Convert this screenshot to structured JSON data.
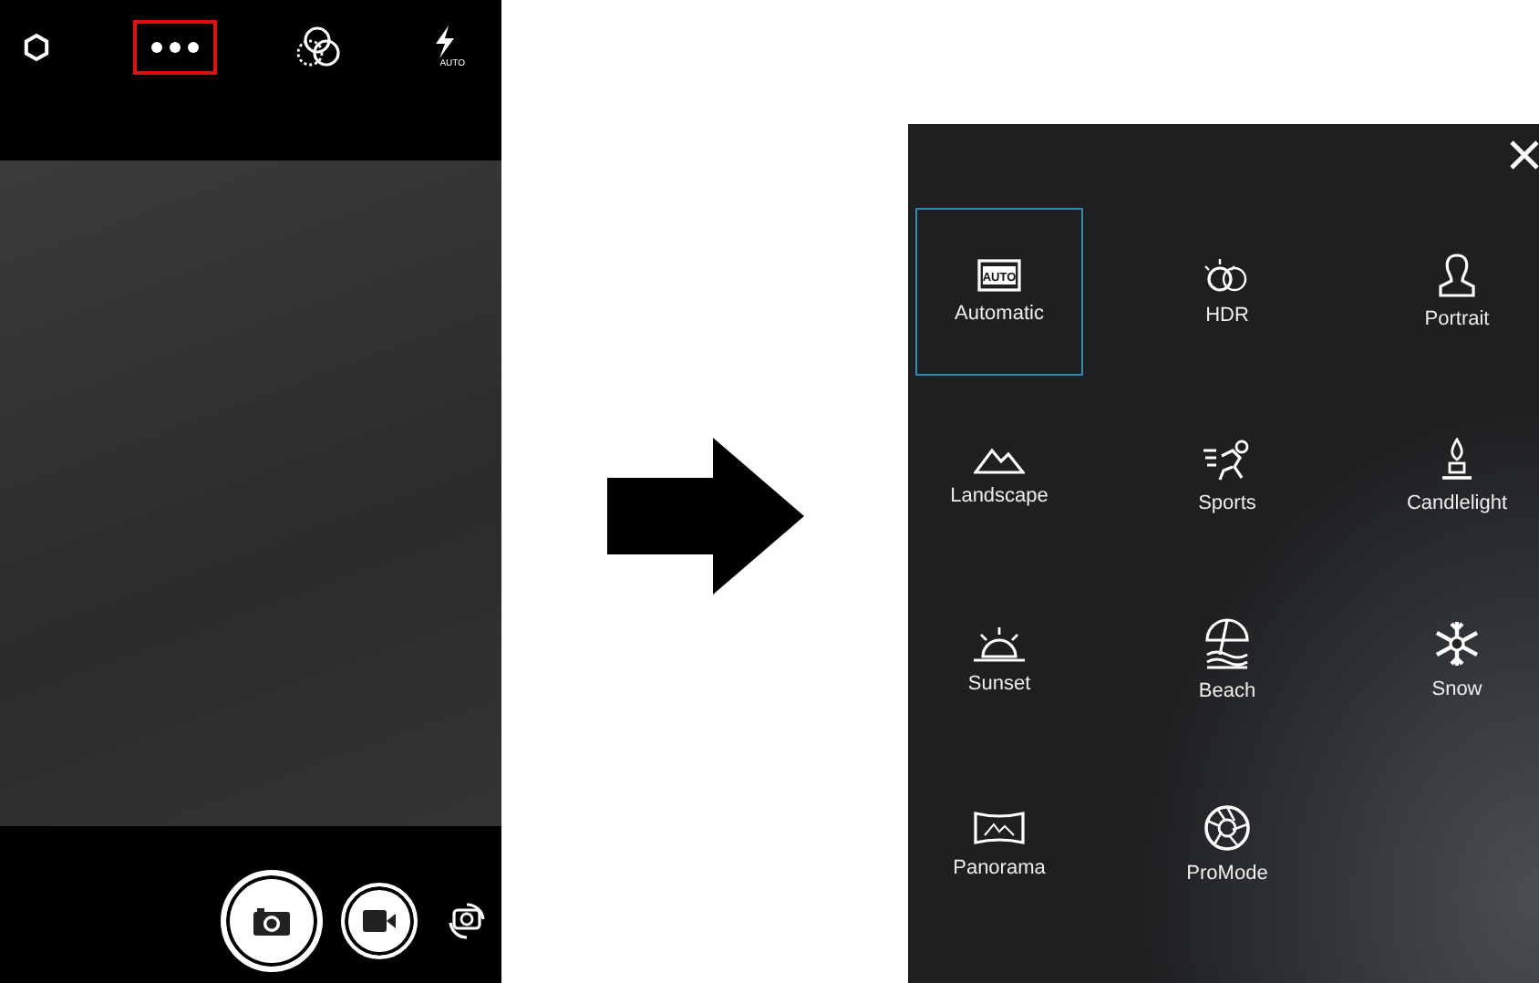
{
  "camera_screen": {
    "top_bar": [
      {
        "kind": "settings",
        "highlighted": false
      },
      {
        "kind": "more",
        "highlighted": true
      },
      {
        "kind": "filters",
        "highlighted": false
      },
      {
        "kind": "flash",
        "highlighted": false,
        "badge": "AUTO"
      }
    ],
    "bottom_bar": [
      {
        "kind": "shutter"
      },
      {
        "kind": "video"
      },
      {
        "kind": "switch"
      }
    ]
  },
  "mode_screen": {
    "modes": [
      {
        "kind": "auto",
        "label": "Automatic",
        "selected": true,
        "icon_text": "AUTO"
      },
      {
        "kind": "hdr",
        "label": "HDR",
        "selected": false
      },
      {
        "kind": "portrait",
        "label": "Portrait",
        "selected": false
      },
      {
        "kind": "landscape",
        "label": "Landscape",
        "selected": false
      },
      {
        "kind": "sports",
        "label": "Sports",
        "selected": false
      },
      {
        "kind": "candle",
        "label": "Candlelight",
        "selected": false
      },
      {
        "kind": "sunset",
        "label": "Sunset",
        "selected": false
      },
      {
        "kind": "beach",
        "label": "Beach",
        "selected": false
      },
      {
        "kind": "snow",
        "label": "Snow",
        "selected": false
      },
      {
        "kind": "panorama",
        "label": "Panorama",
        "selected": false
      },
      {
        "kind": "pro",
        "label": "ProMode",
        "selected": false
      }
    ]
  }
}
